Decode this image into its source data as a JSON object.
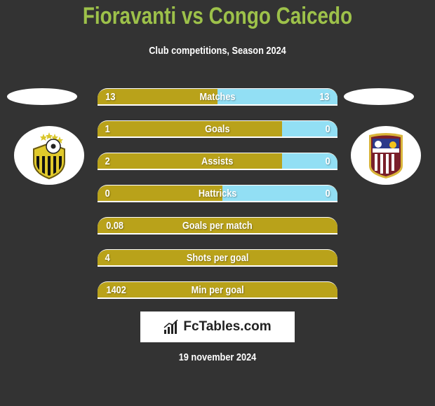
{
  "header": {
    "title": "Fioravanti vs Congo Caicedo",
    "subtitle": "Club competitions, Season 2024"
  },
  "players": {
    "left": {
      "club_logo_icon": "deportivo-tachira-style-crest"
    },
    "right": {
      "club_logo_icon": "carabobo-fc-crest"
    }
  },
  "colors": {
    "title": "#9dc14a",
    "left_bar": "#b9a21a",
    "right_bar": "#92dff4",
    "background": "#333333"
  },
  "stats": [
    {
      "label": "Matches",
      "left": "13",
      "right": "13",
      "left_share": 0.5
    },
    {
      "label": "Goals",
      "left": "1",
      "right": "0",
      "left_share": 0.77
    },
    {
      "label": "Assists",
      "left": "2",
      "right": "0",
      "left_share": 0.77
    },
    {
      "label": "Hattricks",
      "left": "0",
      "right": "0",
      "left_share": 0.52
    },
    {
      "label": "Goals per match",
      "left": "0.08",
      "right": "",
      "left_share": 1.0
    },
    {
      "label": "Shots per goal",
      "left": "4",
      "right": "",
      "left_share": 1.0
    },
    {
      "label": "Min per goal",
      "left": "1402",
      "right": "",
      "left_share": 1.0
    }
  ],
  "footer": {
    "brand": "FcTables.com",
    "date": "19 november 2024"
  }
}
